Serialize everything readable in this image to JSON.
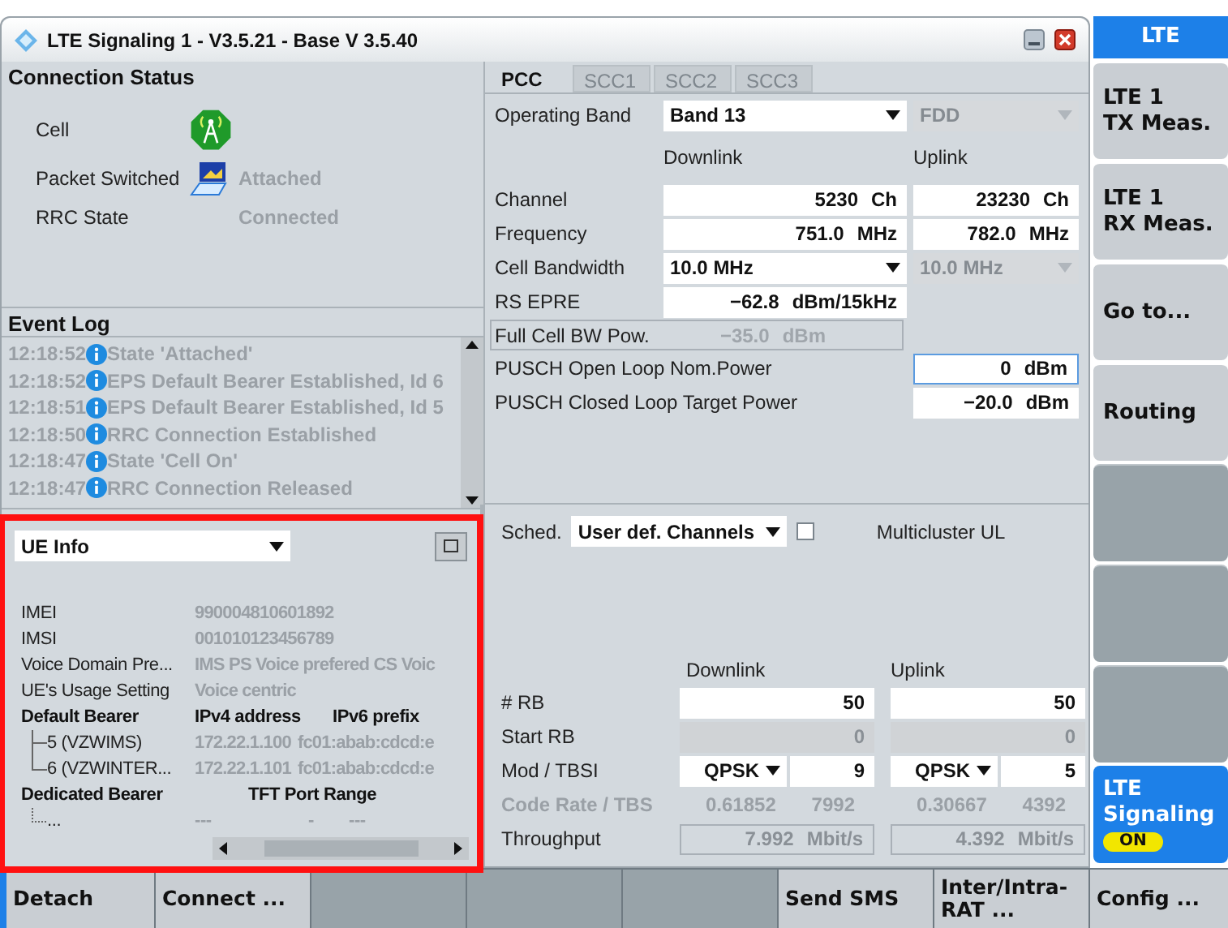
{
  "window": {
    "title": "LTE Signaling 1 - V3.5.21 - Base V 3.5.40"
  },
  "connection_status": {
    "title": "Connection Status",
    "rows": [
      {
        "label": "Cell",
        "kind": "cell"
      },
      {
        "label": "Packet Switched",
        "kind": "laptop",
        "value": "Attached"
      },
      {
        "label": "RRC State",
        "kind": "text",
        "value": "Connected"
      }
    ]
  },
  "event_log": {
    "title": "Event Log",
    "entries": [
      {
        "time": "12:18:52",
        "text": "State 'Attached'"
      },
      {
        "time": "12:18:52",
        "text": "EPS Default Bearer Established, Id 6"
      },
      {
        "time": "12:18:51",
        "text": "EPS Default Bearer Established, Id 5"
      },
      {
        "time": "12:18:50",
        "text": "RRC Connection Established"
      },
      {
        "time": "12:18:47",
        "text": "State 'Cell On'"
      },
      {
        "time": "12:18:47",
        "text": "RRC Connection Released"
      }
    ]
  },
  "ue_info": {
    "selector": "UE Info",
    "highlighted": true,
    "fields": [
      {
        "label": "IMEI",
        "value": "990004810601892"
      },
      {
        "label": "IMSI",
        "value": "001010123456789"
      },
      {
        "label": "Voice Domain Pre...",
        "value": "IMS PS Voice prefered CS Voic"
      },
      {
        "label": "UE's Usage Setting",
        "value": "Voice centric"
      }
    ],
    "default_bearer": {
      "label": "Default Bearer",
      "columns": [
        "IPv4 address",
        "IPv6 prefix"
      ],
      "children": [
        {
          "label": "5 (VZWIMS)",
          "ipv4": "172.22.1.100",
          "ipv6": "fc01:abab:cdcd:e"
        },
        {
          "label": "6 (VZWINTER...",
          "ipv4": "172.22.1.101",
          "ipv6": "fc01:abab:cdcd:e"
        }
      ]
    },
    "dedicated_bearer": {
      "label": "Dedicated Bearer",
      "column": "TFT Port Range",
      "children": [
        {
          "label": "...",
          "from": "---",
          "sep": "-",
          "to": "---"
        }
      ]
    }
  },
  "carrier_tabs": [
    {
      "label": "PCC",
      "selected": true
    },
    {
      "label": "SCC1",
      "selected": false
    },
    {
      "label": "SCC2",
      "selected": false
    },
    {
      "label": "SCC3",
      "selected": false
    }
  ],
  "pcc": {
    "headers": [
      "Downlink",
      "Uplink"
    ],
    "rows": [
      {
        "kind": "dropdowns",
        "label": "Operating Band",
        "downlink": "Band 13",
        "uplink": "FDD",
        "uplink_disabled": true
      },
      {
        "kind": "headers"
      },
      {
        "kind": "pair",
        "label": "Channel",
        "downlink": "5230",
        "dl_unit": "Ch",
        "uplink": "23230",
        "ul_unit": "Ch"
      },
      {
        "kind": "pair",
        "label": "Frequency",
        "downlink": "751.0",
        "dl_unit": "MHz",
        "uplink": "782.0",
        "ul_unit": "MHz"
      },
      {
        "kind": "dropdowns",
        "label": "Cell Bandwidth",
        "downlink": "10.0 MHz",
        "uplink": "10.0 MHz",
        "uplink_disabled": true
      },
      {
        "kind": "downlink",
        "label": "RS EPRE",
        "downlink": "−62.8",
        "dl_unit": "dBm/15kHz"
      },
      {
        "kind": "readonly",
        "label": "Full Cell BW Pow.",
        "downlink": "−35.0",
        "dl_unit": "dBm"
      },
      {
        "kind": "uplink",
        "label": "PUSCH Open Loop Nom.Power",
        "uplink": "0",
        "ul_unit": "dBm",
        "focused": true
      },
      {
        "kind": "uplink",
        "label": "PUSCH Closed Loop Target Power",
        "uplink": "−20.0",
        "ul_unit": "dBm",
        "focused": false
      }
    ]
  },
  "scheduling": {
    "label": "Sched.",
    "value": "User def. Channels",
    "multicluster_checked": false,
    "multicluster_label": "Multicluster UL",
    "headers": [
      "Downlink",
      "Uplink"
    ],
    "rows": [
      {
        "kind": "field",
        "label": "# RB",
        "downlink": "50",
        "uplink": "50"
      },
      {
        "kind": "disabled",
        "label": "Start RB",
        "downlink": "0",
        "uplink": "0"
      },
      {
        "kind": "mod",
        "label": "Mod / TBSI",
        "dl_mod": "QPSK",
        "downlink": "9",
        "ul_mod": "QPSK",
        "uplink": "5"
      },
      {
        "kind": "text",
        "label": "Code Rate / TBS",
        "dl_rate": "0.61852",
        "downlink": "7992",
        "ul_rate": "0.30667",
        "uplink": "4392"
      },
      {
        "kind": "readonly",
        "label": "Throughput",
        "downlink": "7.992",
        "dl_unit": "Mbit/s",
        "uplink": "4.392",
        "ul_unit": "Mbit/s"
      }
    ]
  },
  "softkeys": {
    "header": "LTE",
    "items": [
      {
        "kind": "button",
        "lines": [
          "LTE 1",
          "TX Meas."
        ]
      },
      {
        "kind": "button",
        "lines": [
          "LTE 1",
          "RX Meas."
        ]
      },
      {
        "kind": "button",
        "lines": [
          "Go to..."
        ]
      },
      {
        "kind": "button",
        "lines": [
          "Routing"
        ]
      },
      {
        "kind": "empty"
      },
      {
        "kind": "empty"
      },
      {
        "kind": "empty"
      },
      {
        "kind": "active",
        "lines": [
          "LTE",
          "Signaling"
        ],
        "badge": "ON"
      }
    ]
  },
  "bottom_keys": [
    {
      "kind": "button",
      "lines": [
        "Detach"
      ],
      "selected": true
    },
    {
      "kind": "button",
      "lines": [
        "Connect ..."
      ],
      "selected": false
    },
    {
      "kind": "empty"
    },
    {
      "kind": "empty"
    },
    {
      "kind": "empty"
    },
    {
      "kind": "button",
      "lines": [
        "Send SMS"
      ],
      "selected": false
    },
    {
      "kind": "button",
      "lines": [
        "Inter/Intra-",
        "RAT ..."
      ],
      "selected": false
    },
    {
      "kind": "button",
      "lines": [
        "Config ..."
      ],
      "selected": false
    }
  ]
}
